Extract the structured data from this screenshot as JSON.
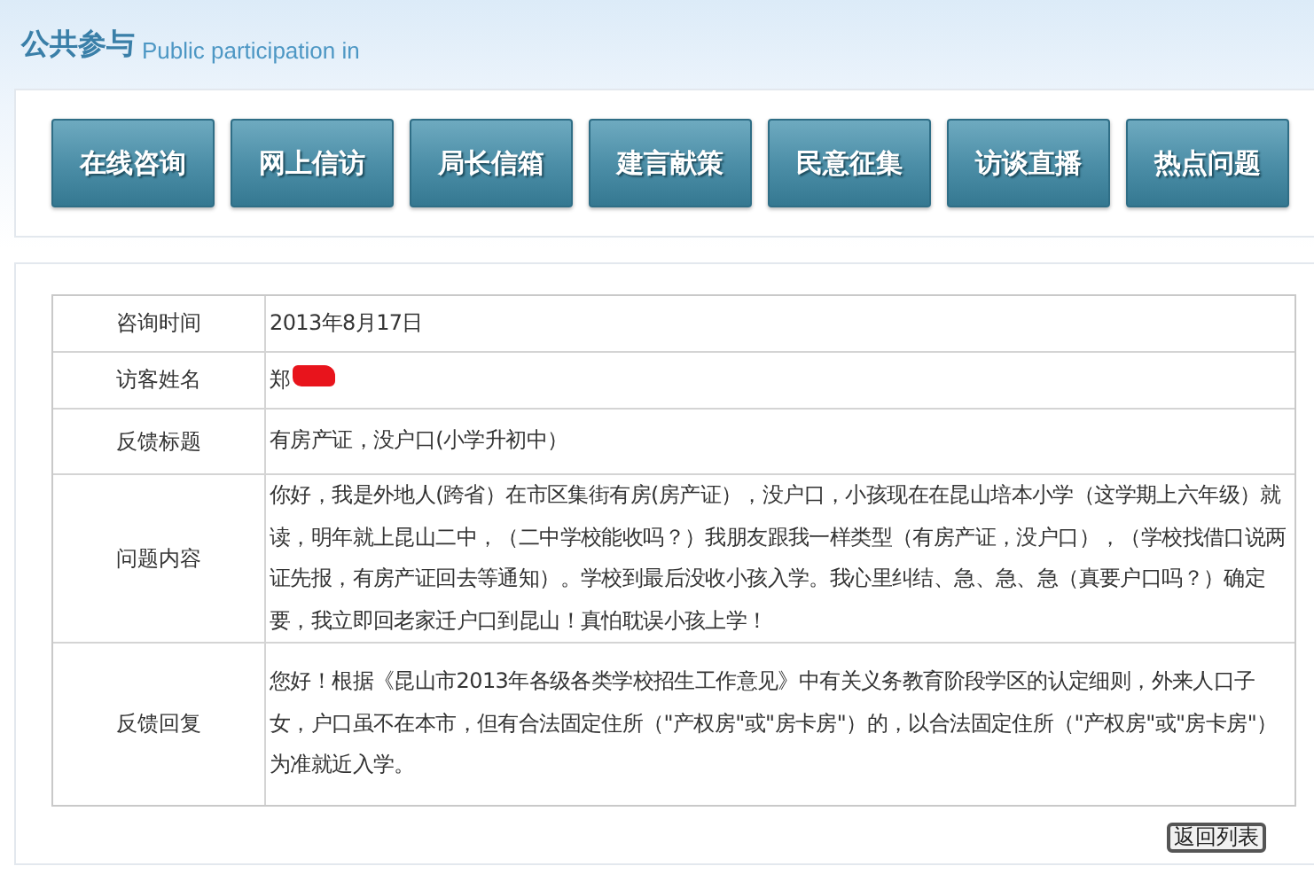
{
  "header": {
    "title": "公共参与",
    "subtitle": "Public participation in"
  },
  "nav_buttons": [
    "在线咨询",
    "网上信访",
    "局长信箱",
    "建言献策",
    "民意征集",
    "访谈直播",
    "热点问题"
  ],
  "detail_rows": [
    {
      "label": "咨询时间",
      "value": "2013年8月17日"
    },
    {
      "label": "访客姓名",
      "value": "郑",
      "redacted": true
    },
    {
      "label": "反馈标题",
      "value": "有房产证，没户口(小学升初中）"
    },
    {
      "label": "问题内容",
      "value": "你好，我是外地人(跨省）在市区集街有房(房产证），没户口，小孩现在在昆山培本小学（这学期上六年级）就读，明年就上昆山二中，（二中学校能收吗？）我朋友跟我一样类型（有房产证，没户口），（学校找借口说两证先报，有房产证回去等通知）。学校到最后没收小孩入学。我心里纠结、急、急、急（真要户口吗？）确定要，我立即回老家迁户口到昆山！真怕耽误小孩上学！"
    },
    {
      "label": "反馈回复",
      "value": "您好！根据《昆山市2013年各级各类学校招生工作意见》中有关义务教育阶段学区的认定细则，外来人口子女，户口虽不在本市，但有合法固定住所（\"产权房\"或\"房卡房\"）的，以合法固定住所（\"产权房\"或\"房卡房\"）为准就近入学。"
    }
  ],
  "back_button": "返回列表"
}
